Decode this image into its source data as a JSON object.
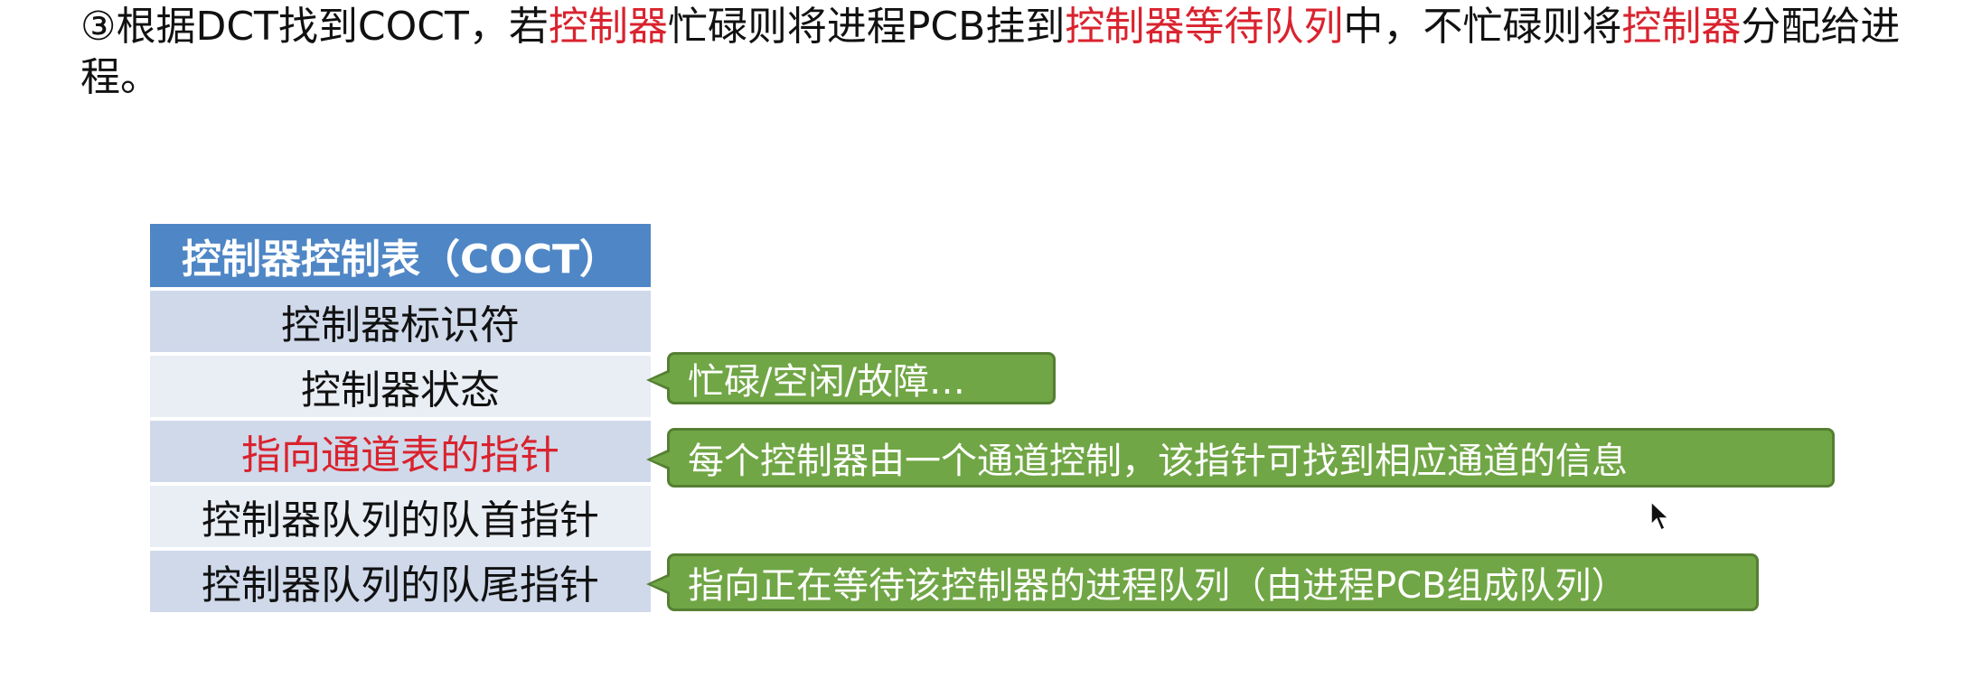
{
  "intro": {
    "seg1": "③根据DCT找到COCT，若",
    "seg2": "控制器",
    "seg3": "忙碌则将进程PCB挂到",
    "seg4": "控制器等待队列",
    "seg5": "中，不忙碌则将",
    "seg6": "控制器",
    "seg7": "分配给进程。"
  },
  "table": {
    "header": "控制器控制表（COCT）",
    "rows": [
      "控制器标识符",
      "控制器状态",
      "指向通道表的指针",
      "控制器队列的队首指针",
      "控制器队列的队尾指针"
    ]
  },
  "callouts": {
    "status": "忙碌/空闲/故障…",
    "channel": "每个控制器由一个通道控制，该指针可找到相应通道的信息",
    "queue": "指向正在等待该控制器的进程队列（由进程PCB组成队列）"
  },
  "colors": {
    "highlight": "#d9232e",
    "header_bg": "#4f86c6",
    "row_dark": "#cfd9ea",
    "row_light": "#e9edf4",
    "callout_bg": "#70a645"
  }
}
